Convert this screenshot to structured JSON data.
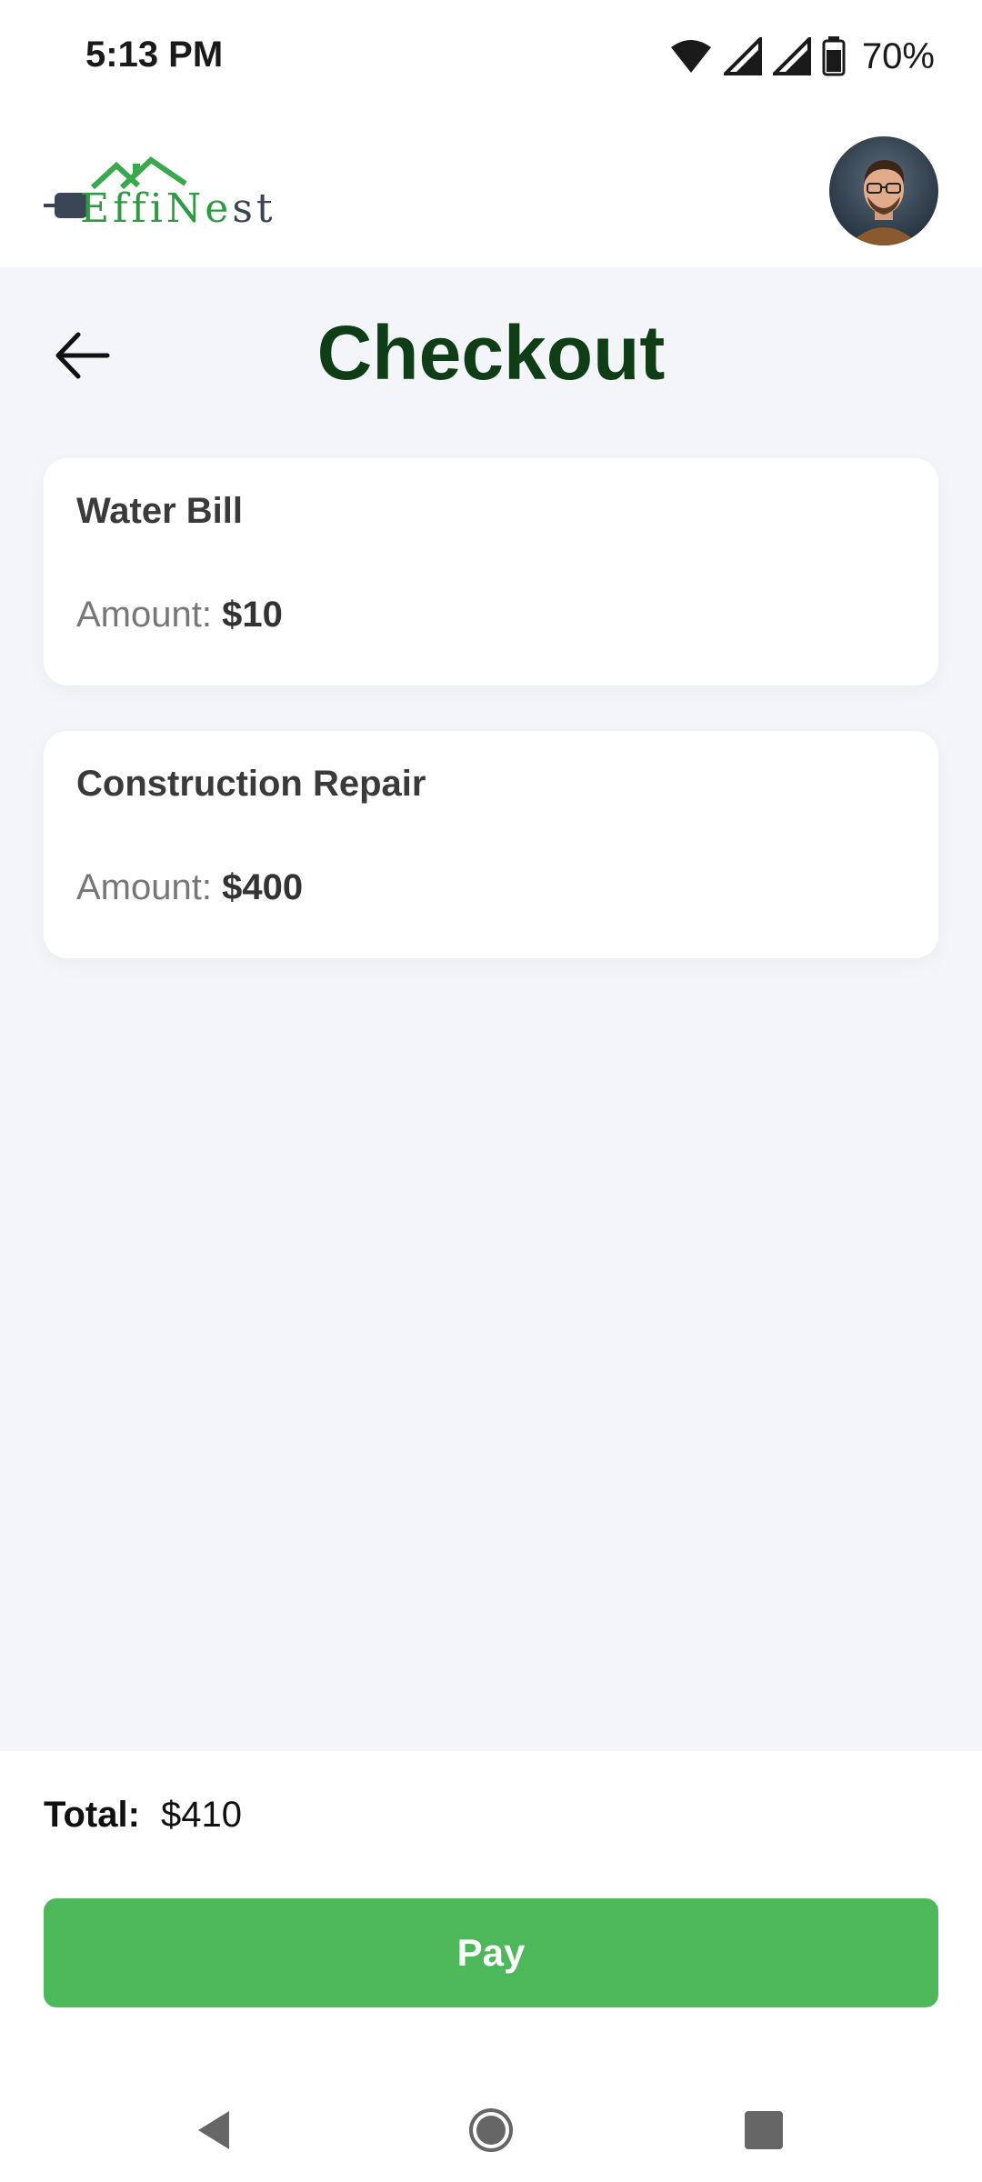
{
  "status_bar": {
    "time": "5:13 PM",
    "battery_percent": "70%",
    "icons": [
      "wifi-icon",
      "cell-signal-icon",
      "cell-signal-icon",
      "battery-icon"
    ]
  },
  "app_header": {
    "logo_text_prefix": "E",
    "logo_text_main": "ffiN",
    "logo_text_e": "e",
    "logo_text_suffix": "st",
    "avatar_icon": "profile-avatar"
  },
  "page": {
    "title": "Checkout",
    "back_icon": "arrow-left-icon"
  },
  "items": [
    {
      "name": "Water Bill",
      "amount_label": "Amount:",
      "amount_value": "$10"
    },
    {
      "name": "Construction Repair",
      "amount_label": "Amount:",
      "amount_value": "$400"
    }
  ],
  "summary": {
    "total_label": "Total:",
    "total_value": "$410",
    "pay_label": "Pay"
  },
  "nav": {
    "icons": [
      "nav-back-icon",
      "nav-home-icon",
      "nav-recents-icon"
    ]
  },
  "colors": {
    "brand_green": "#4cb85a",
    "title_green": "#0e3d16",
    "background": "#f3f5f9"
  }
}
